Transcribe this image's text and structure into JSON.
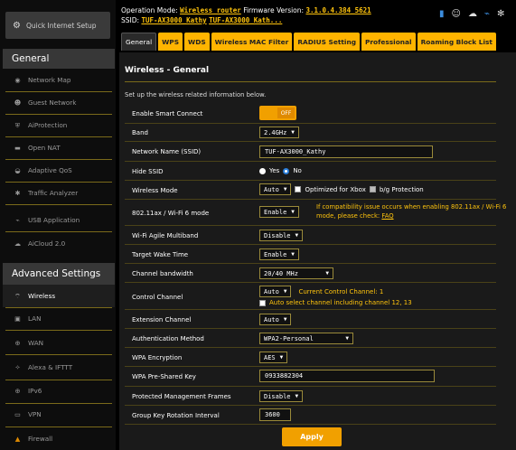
{
  "header": {
    "opmode_label": "Operation Mode:",
    "opmode_value": "Wireless router",
    "fw_label": "Firmware Version:",
    "fw_value": "3.1.0.4.384_5621",
    "ssid_label": "SSID:",
    "ssid_value1": "TUF-AX3000_Kathy",
    "ssid_value2": "TUF-AX3000_Kath..."
  },
  "sidebar": {
    "qis": "Quick Internet Setup",
    "general_title": "General",
    "general_items": [
      "Network Map",
      "Guest Network",
      "AiProtection",
      "Open NAT",
      "Adaptive QoS",
      "Traffic Analyzer",
      "USB Application",
      "AiCloud 2.0"
    ],
    "advanced_title": "Advanced Settings",
    "advanced_items": [
      "Wireless",
      "LAN",
      "WAN",
      "Alexa & IFTTT",
      "IPv6",
      "VPN",
      "Firewall"
    ]
  },
  "tabs": [
    "General",
    "WPS",
    "WDS",
    "Wireless MAC Filter",
    "RADIUS Setting",
    "Professional",
    "Roaming Block List"
  ],
  "page": {
    "title": "Wireless - General",
    "description": "Set up the wireless related information below."
  },
  "form": {
    "smart_connect": {
      "label": "Enable Smart Connect",
      "state": "OFF"
    },
    "band": {
      "label": "Band",
      "value": "2.4GHz"
    },
    "ssid": {
      "label": "Network Name (SSID)",
      "value": "TUF-AX3000_Kathy"
    },
    "hide_ssid": {
      "label": "Hide SSID",
      "yes": "Yes",
      "no": "No",
      "selected": "No"
    },
    "wireless_mode": {
      "label": "Wireless Mode",
      "value": "Auto",
      "xbox": "Optimized for Xbox",
      "bg": "b/g Protection"
    },
    "ax_mode": {
      "label": "802.11ax / Wi-Fi 6 mode",
      "value": "Enable",
      "note1": "If compatibility issue occurs when enabling 802.11ax / Wi-Fi 6",
      "note2": "mode, please check:",
      "faq": "FAQ"
    },
    "agile": {
      "label": "Wi-Fi Agile Multiband",
      "value": "Disable"
    },
    "twt": {
      "label": "Target Wake Time",
      "value": "Enable"
    },
    "bandwidth": {
      "label": "Channel bandwidth",
      "value": "20/40 MHz"
    },
    "control": {
      "label": "Control Channel",
      "value": "Auto",
      "current": "Current Control Channel: 1",
      "auto_select": "Auto select channel including channel 12, 13"
    },
    "extension": {
      "label": "Extension Channel",
      "value": "Auto"
    },
    "auth": {
      "label": "Authentication Method",
      "value": "WPA2-Personal"
    },
    "encryption": {
      "label": "WPA Encryption",
      "value": "AES"
    },
    "psk": {
      "label": "WPA Pre-Shared Key",
      "value": "0933882304"
    },
    "pmf": {
      "label": "Protected Management Frames",
      "value": "Disable"
    },
    "gkri": {
      "label": "Group Key Rotation Interval",
      "value": "3600"
    }
  },
  "apply_label": "Apply",
  "colors": {
    "accent": "#f1a000",
    "highlight": "#ffc40d",
    "background": "#1a1a1a"
  }
}
